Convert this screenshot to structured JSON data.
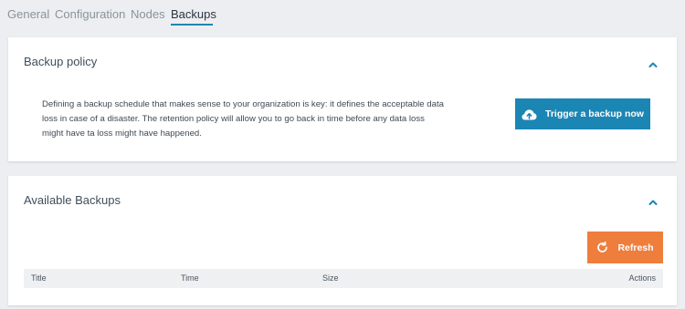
{
  "tabs": [
    {
      "label": "General"
    },
    {
      "label": "Configuration"
    },
    {
      "label": "Nodes"
    },
    {
      "label": "Backups"
    }
  ],
  "active_tab": "Backups",
  "backup_policy": {
    "title": "Backup policy",
    "description": "Defining a backup schedule that makes sense to your organization is key: it defines the acceptable data loss in case of a disaster. The retention policy will allow you to go back in time before any data loss might have ta loss might have happened.",
    "trigger_button": {
      "label": "Trigger a backup now",
      "icon": "cloud-upload-icon"
    },
    "collapse_icon": "chevron-up-icon"
  },
  "available_backups": {
    "title": "Available Backups",
    "refresh_button": {
      "label": "Refresh",
      "icon": "refresh-icon"
    },
    "collapse_icon": "chevron-up-icon",
    "columns": [
      "Title",
      "Time",
      "Size",
      "Actions"
    ]
  },
  "colors": {
    "accent": "#1b86b4",
    "refresh": "#ef7e3d",
    "background": "#eceef1"
  }
}
